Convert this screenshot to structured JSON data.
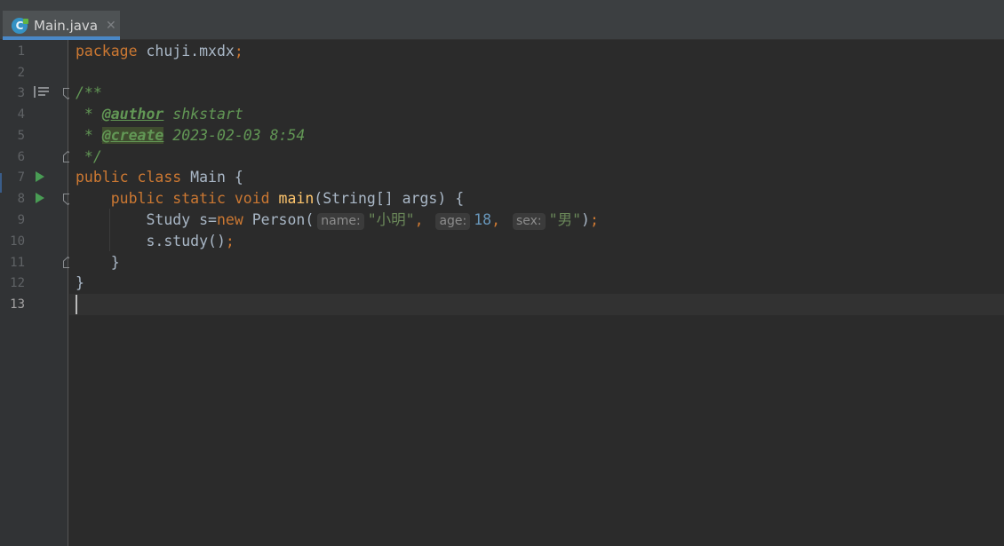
{
  "tabs": [
    {
      "label": "Main.java",
      "icon": "java-class-icon",
      "icon_letter": "C",
      "active": true
    }
  ],
  "gutter": {
    "line_numbers": [
      "1",
      "2",
      "3",
      "4",
      "5",
      "6",
      "7",
      "8",
      "9",
      "10",
      "11",
      "12",
      "13"
    ],
    "current_line": "13",
    "run_markers_lines": [
      "7",
      "8"
    ]
  },
  "code": {
    "line1": {
      "kw": "package",
      "rest": " chuji.mxdx",
      "semi": ";"
    },
    "line3": {
      "comment_open": "/**"
    },
    "line4": {
      "star": " * ",
      "tag": "@author",
      "value": " shkstart"
    },
    "line5": {
      "star": " * ",
      "tag": "@create",
      "value": " 2023-02-03 8:54"
    },
    "line6": {
      "comment_close": " */"
    },
    "line7": {
      "kw1": "public",
      "kw2": "class",
      "name": "Main",
      "brace": " {"
    },
    "line8": {
      "indent": "    ",
      "kw1": "public",
      "kw2": "static",
      "kw3": "void",
      "method": "main",
      "params": "(String[] args) {"
    },
    "line9": {
      "indent": "        ",
      "pre": "Study s=",
      "kw": "new",
      "cls": " Person(",
      "hint_name": "name:",
      "arg_name": "\"小明\"",
      "comma1": ",",
      "hint_age": "age:",
      "arg_age": "18",
      "comma2": ",",
      "hint_sex": "sex:",
      "arg_sex": "\"男\"",
      "close": ")",
      "semi": ";"
    },
    "line10": {
      "indent": "        ",
      "text": "s.study()",
      "semi": ";"
    },
    "line11": {
      "indent": "    ",
      "text": "}"
    },
    "line12": {
      "text": "}"
    }
  },
  "colors": {
    "keyword": "#cc7832",
    "method": "#ffc66d",
    "string": "#6a8759",
    "number": "#6897bb",
    "comment": "#629755",
    "default": "#a9b7c6",
    "background": "#2b2b2b",
    "gutter": "#313335",
    "tab_underline": "#4a88c7"
  }
}
